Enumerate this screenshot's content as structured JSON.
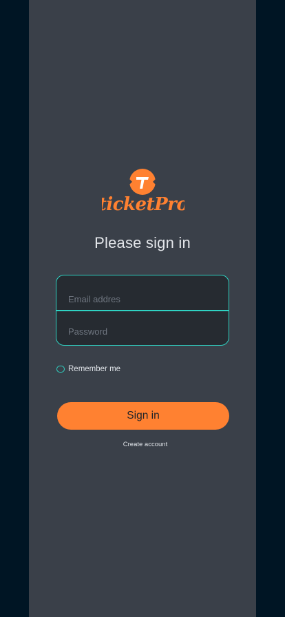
{
  "brand": {
    "name": "ticketPro",
    "logo_letter": "T",
    "accent_color": "#ff8131",
    "focus_color": "#2fd3c3"
  },
  "form": {
    "title": "Please sign in",
    "email_placeholder": "Email addres",
    "password_placeholder": "Password",
    "remember_label": "Remember me",
    "submit_label": "Sign in",
    "create_account_label": "Create account"
  }
}
